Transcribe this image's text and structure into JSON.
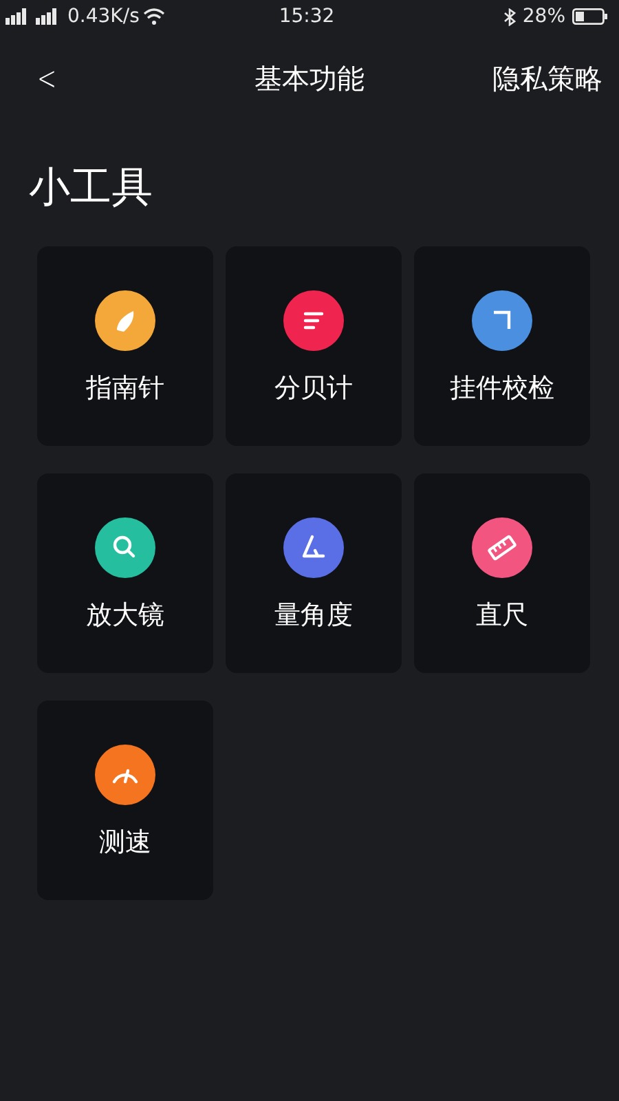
{
  "status_bar": {
    "network_speed": "0.43K/s",
    "time": "15:32",
    "battery": "28%"
  },
  "nav": {
    "back": "<",
    "title": "基本功能",
    "action": "隐私策略"
  },
  "section_title": "小工具",
  "tools": [
    {
      "label": "指南针",
      "kind": "compass",
      "color": "#f4a83a"
    },
    {
      "label": "分贝计",
      "kind": "decibel",
      "color": "#f0254f"
    },
    {
      "label": "挂件校检",
      "kind": "level",
      "color": "#4a8fe0"
    },
    {
      "label": "放大镜",
      "kind": "magnifier",
      "color": "#25bfa0"
    },
    {
      "label": "量角度",
      "kind": "angle",
      "color": "#5a6fe6"
    },
    {
      "label": "直尺",
      "kind": "ruler",
      "color": "#f25680"
    },
    {
      "label": "测速",
      "kind": "speed",
      "color": "#f47420"
    }
  ]
}
